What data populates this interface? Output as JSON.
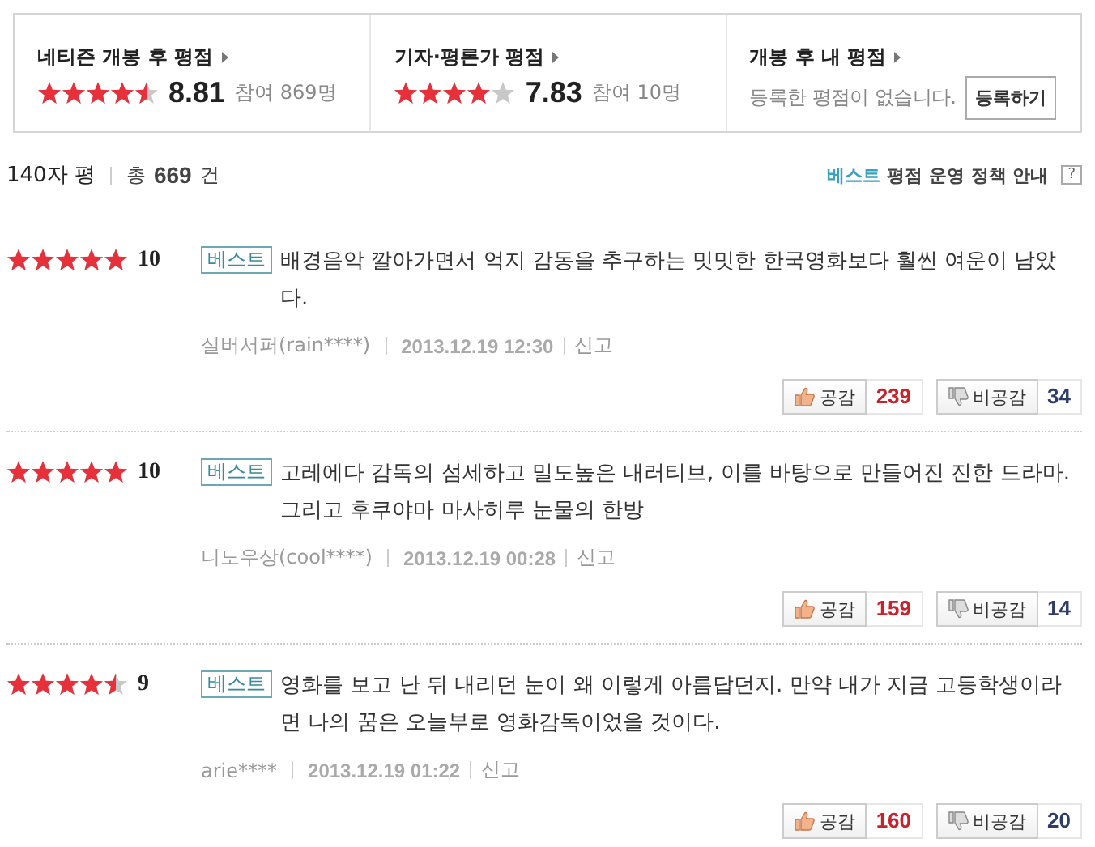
{
  "scores": [
    {
      "title": "네티즌 개봉 후 평점",
      "stars": 4.5,
      "score": "8.81",
      "participants": "참여 869명"
    },
    {
      "title": "기자·평론가 평점",
      "stars": 4,
      "score": "7.83",
      "participants": "참여 10명"
    },
    {
      "title": "개봉 후 내 평점",
      "message": "등록한 평점이 없습니다.",
      "button": "등록하기"
    }
  ],
  "list_header": {
    "title": "140자 평",
    "total_label": "총",
    "total": "669",
    "total_unit": "건",
    "policy_highlight": "베스트",
    "policy": "평점 운영 정책 안내",
    "help": "?"
  },
  "reviews": [
    {
      "stars": 5,
      "score": "10",
      "badge": "베스트",
      "text": "배경음악 깔아가면서 억지 감동을 추구하는 밋밋한 한국영화보다 훨씬 여운이 남았다.",
      "author": "실버서퍼(rain****)",
      "date": "2013.12.19 12:30",
      "report": "신고",
      "like_label": "공감",
      "likes": "239",
      "dislike_label": "비공감",
      "dislikes": "34"
    },
    {
      "stars": 5,
      "score": "10",
      "badge": "베스트",
      "text": "고레에다 감독의 섬세하고 밀도높은 내러티브, 이를 바탕으로 만들어진 진한 드라마. 그리고 후쿠야마 마사히루 눈물의 한방",
      "author": "니노우상(cool****)",
      "date": "2013.12.19 00:28",
      "report": "신고",
      "like_label": "공감",
      "likes": "159",
      "dislike_label": "비공감",
      "dislikes": "14"
    },
    {
      "stars": 4.5,
      "score": "9",
      "badge": "베스트",
      "text": "영화를 보고 난 뒤 내리던 눈이 왜 이렇게 아름답던지. 만약 내가 지금 고등학생이라면 나의 꿈은 오늘부로 영화감독이었을 것이다.",
      "author": "arie****",
      "date": "2013.12.19 01:22",
      "report": "신고",
      "like_label": "공감",
      "likes": "160",
      "dislike_label": "비공감",
      "dislikes": "20"
    }
  ]
}
